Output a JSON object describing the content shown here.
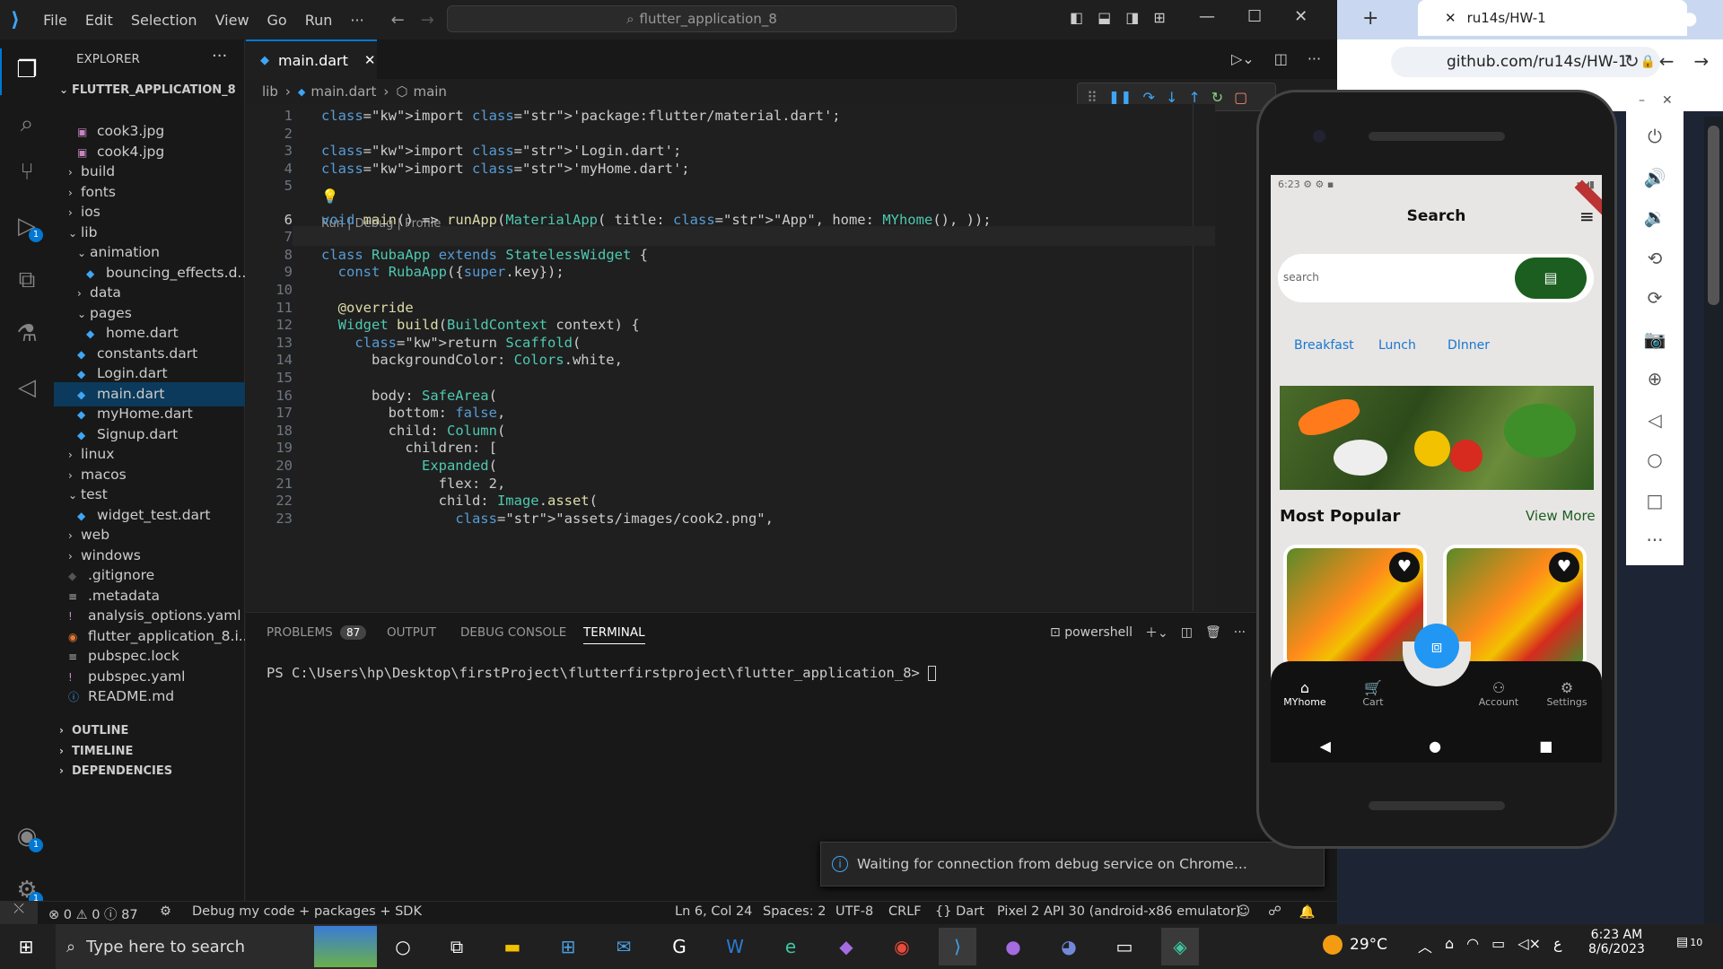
{
  "vscode": {
    "menu": [
      "File",
      "Edit",
      "Selection",
      "View",
      "Go",
      "Run",
      "···"
    ],
    "command_center": "flutter_application_8",
    "explorer": {
      "title": "EXPLORER",
      "project": "FLUTTER_APPLICATION_8",
      "tree": [
        {
          "label": "cook3.jpg",
          "indent": 2,
          "icon": "image"
        },
        {
          "label": "cook4.jpg",
          "indent": 2,
          "icon": "image"
        },
        {
          "label": "build",
          "indent": 1,
          "icon": "folder-closed"
        },
        {
          "label": "fonts",
          "indent": 1,
          "icon": "folder-closed"
        },
        {
          "label": "ios",
          "indent": 1,
          "icon": "folder-closed"
        },
        {
          "label": "lib",
          "indent": 1,
          "icon": "folder-open"
        },
        {
          "label": "animation",
          "indent": 2,
          "icon": "folder-open"
        },
        {
          "label": "bouncing_effects.d...",
          "indent": 3,
          "icon": "dart"
        },
        {
          "label": "data",
          "indent": 2,
          "icon": "folder-closed"
        },
        {
          "label": "pages",
          "indent": 2,
          "icon": "folder-open"
        },
        {
          "label": "home.dart",
          "indent": 3,
          "icon": "dart"
        },
        {
          "label": "constants.dart",
          "indent": 2,
          "icon": "dart"
        },
        {
          "label": "Login.dart",
          "indent": 2,
          "icon": "dart"
        },
        {
          "label": "main.dart",
          "indent": 2,
          "icon": "dart",
          "selected": true
        },
        {
          "label": "myHome.dart",
          "indent": 2,
          "icon": "dart"
        },
        {
          "label": "Signup.dart",
          "indent": 2,
          "icon": "dart"
        },
        {
          "label": "linux",
          "indent": 1,
          "icon": "folder-closed"
        },
        {
          "label": "macos",
          "indent": 1,
          "icon": "folder-closed"
        },
        {
          "label": "test",
          "indent": 1,
          "icon": "folder-open"
        },
        {
          "label": "widget_test.dart",
          "indent": 2,
          "icon": "dart"
        },
        {
          "label": "web",
          "indent": 1,
          "icon": "folder-closed"
        },
        {
          "label": "windows",
          "indent": 1,
          "icon": "folder-closed"
        },
        {
          "label": ".gitignore",
          "indent": 1,
          "icon": "git"
        },
        {
          "label": ".metadata",
          "indent": 1,
          "icon": "lines"
        },
        {
          "label": "analysis_options.yaml",
          "indent": 1,
          "icon": "yaml"
        },
        {
          "label": "flutter_application_8.i...",
          "indent": 1,
          "icon": "rss"
        },
        {
          "label": "pubspec.lock",
          "indent": 1,
          "icon": "lines"
        },
        {
          "label": "pubspec.yaml",
          "indent": 1,
          "icon": "yaml"
        },
        {
          "label": "README.md",
          "indent": 1,
          "icon": "info"
        }
      ],
      "sections": [
        "OUTLINE",
        "TIMELINE",
        "DEPENDENCIES"
      ]
    },
    "tab": "main.dart",
    "breadcrumb": {
      "folder": "lib",
      "file": "main.dart",
      "symbol": "main"
    },
    "codelens": "Run | Debug | Profile",
    "code": [
      "import 'package:flutter/material.dart';",
      "",
      "import 'Login.dart';",
      "import 'myHome.dart';",
      "",
      "void main() => runApp(MaterialApp( title: \"App\", home: MYhome(), ));",
      "",
      "class RubaApp extends StatelessWidget {",
      "  const RubaApp({super.key});",
      "",
      "  @override",
      "  Widget build(BuildContext context) {",
      "    return Scaffold(",
      "      backgroundColor: Colors.white,",
      "",
      "      body: SafeArea(",
      "        bottom: false,",
      "        child: Column(",
      "          children: [",
      "            Expanded(",
      "              flex: 2,",
      "              child: Image.asset(",
      "                \"assets/images/cook2.png\","
    ],
    "panel": {
      "tabs": [
        "PROBLEMS",
        "OUTPUT",
        "DEBUG CONSOLE",
        "TERMINAL"
      ],
      "problems_count": "87",
      "shell": "powershell",
      "prompt": "PS C:\\Users\\hp\\Desktop\\firstProject\\flutterfirstproject\\flutter_application_8> "
    },
    "toast": "Waiting for connection from debug service on Chrome...",
    "status": {
      "errors": "0",
      "warnings": "0",
      "info": "87",
      "debug": "Debug my code + packages + SDK",
      "position": "Ln 6, Col 24",
      "spaces": "Spaces: 2",
      "encoding": "UTF-8",
      "eol": "CRLF",
      "language": "Dart",
      "device": "Pixel 2 API 30 (android-x86 emulator)"
    },
    "badges": {
      "run": "1",
      "accounts": "1",
      "settings": "1"
    }
  },
  "browser": {
    "tab_title": "ru14s/HW-1",
    "url": "github.com/ru14s/HW-1"
  },
  "phone": {
    "status_time": "6:23",
    "app_title": "Search",
    "search_placeholder": "search",
    "categories": [
      "Breakfast",
      "Lunch",
      "DInner"
    ],
    "section_title": "Most Popular",
    "view_more": "View More",
    "nav": [
      "MYhome",
      "Cart",
      "Account",
      "Settings"
    ],
    "accent": "#1b5e20",
    "fab_color": "#2196f3"
  },
  "taskbar": {
    "search": "Type here to search",
    "weather": "29°C",
    "time": "6:23 AM",
    "date": "8/6/2023",
    "notifications": "10",
    "lang": "ع"
  }
}
